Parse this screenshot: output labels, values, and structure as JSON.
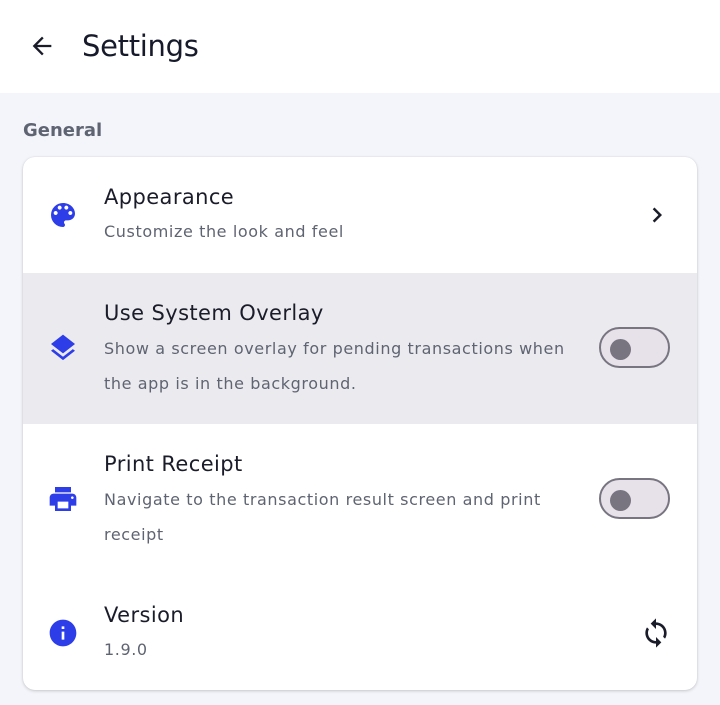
{
  "appbar": {
    "title": "Settings",
    "back_icon": "arrow-back-icon"
  },
  "section": {
    "header": "General"
  },
  "colors": {
    "accent": "#2d3ee8",
    "highlight_row": "#ebebef",
    "toggle_track": "#e7e1ea",
    "toggle_outline": "#787480"
  },
  "settings": {
    "appearance": {
      "title": "Appearance",
      "subtitle": "Customize the look and feel",
      "icon": "palette-icon",
      "trailing_icon": "chevron-right-icon"
    },
    "overlay": {
      "title": "Use System Overlay",
      "subtitle": "Show a screen overlay for pending transactions when the app is in the background.",
      "icon": "layers-icon",
      "enabled": false
    },
    "print_receipt": {
      "title": "Print Receipt",
      "subtitle": "Navigate to the transaction result screen and print receipt",
      "icon": "printer-icon",
      "enabled": false
    },
    "version": {
      "title": "Version",
      "value": "1.9.0",
      "icon": "info-icon",
      "trailing_icon": "sync-icon"
    }
  }
}
